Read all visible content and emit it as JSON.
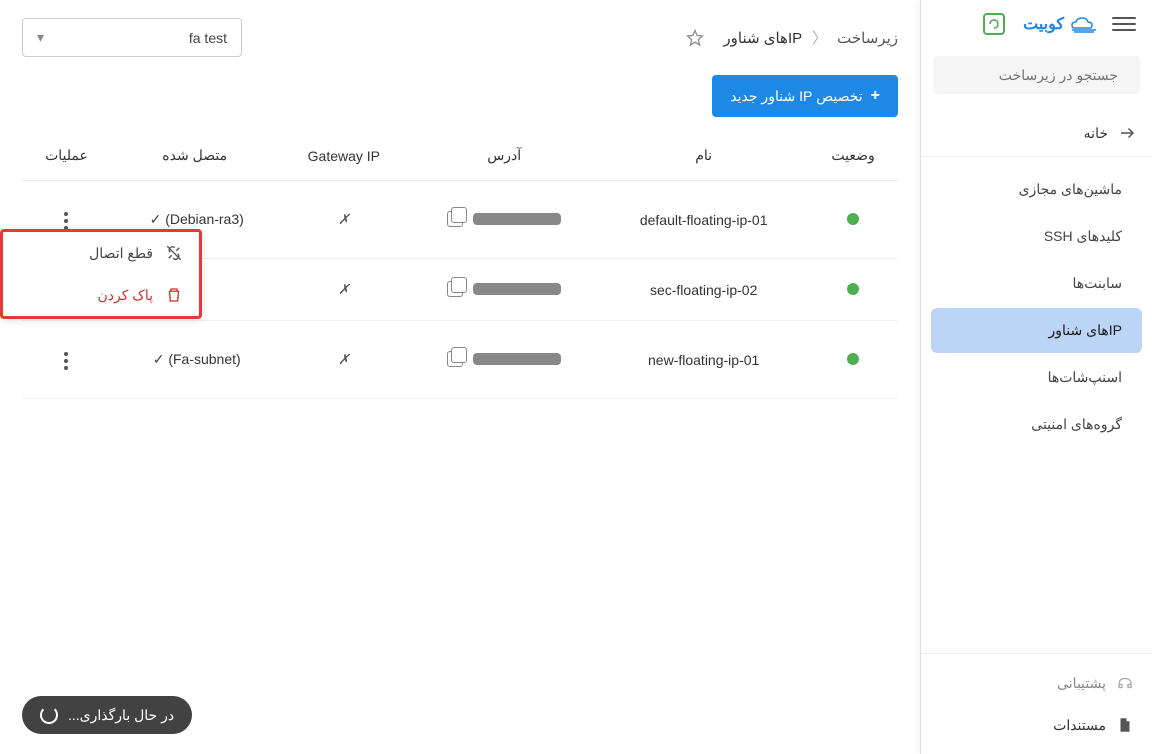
{
  "brand": {
    "name": "کوبیت"
  },
  "search": {
    "placeholder": "جستجو در زیرساخت"
  },
  "sidebar": {
    "home": "خانه",
    "items": [
      {
        "label": "ماشین‌های مجازی",
        "active": false
      },
      {
        "label": "کلیدهای SSH",
        "active": false
      },
      {
        "label": "سابنت‌ها",
        "active": false
      },
      {
        "label": "IPهای شناور",
        "active": true
      },
      {
        "label": "اسنپ‌شات‌ها",
        "active": false
      },
      {
        "label": "گروه‌های امنیتی",
        "active": false
      }
    ],
    "footer": {
      "support": "پشتیبانی",
      "docs": "مستندات"
    }
  },
  "breadcrumb": {
    "root": "زیرساخت",
    "current": "IPهای شناور"
  },
  "project": {
    "selected": "fa test"
  },
  "actions": {
    "new_floating_ip": "تخصیص IP شناور جدید"
  },
  "table": {
    "headers": {
      "status": "وضعیت",
      "name": "نام",
      "address": "آدرس",
      "gateway": "Gateway IP",
      "connected": "متصل شده",
      "ops": "عملیات"
    },
    "rows": [
      {
        "status": "green",
        "name": "default-floating-ip-01",
        "gateway": "✗",
        "connected": "(Debian-ra3)",
        "has_check": true
      },
      {
        "status": "green",
        "name": "sec-floating-ip-02",
        "gateway": "✗",
        "connected": "",
        "has_check": false
      },
      {
        "status": "green",
        "name": "new-floating-ip-01",
        "gateway": "✗",
        "connected": "(Fa-subnet)",
        "has_check": true
      }
    ]
  },
  "popup": {
    "disconnect": "قطع اتصال",
    "delete": "پاک کردن"
  },
  "loading": {
    "text": "در حال بارگذاری..."
  }
}
